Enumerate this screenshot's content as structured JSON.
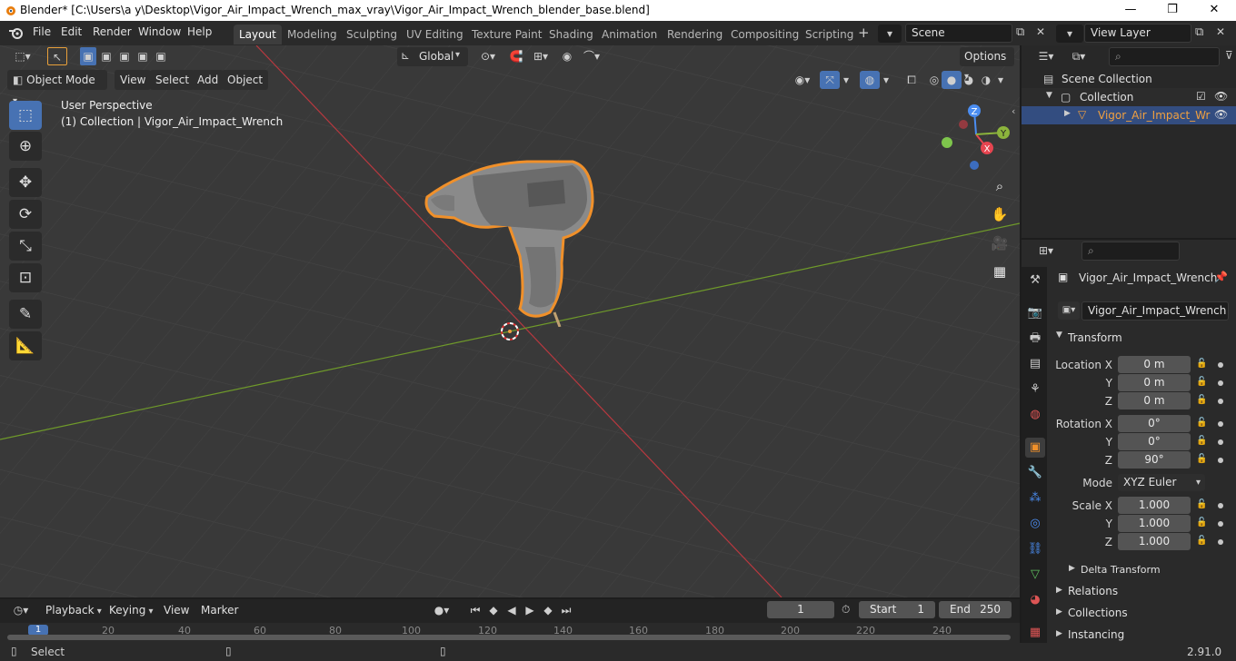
{
  "window": {
    "title": "Blender* [C:\\Users\\a y\\Desktop\\Vigor_Air_Impact_Wrench_max_vray\\Vigor_Air_Impact_Wrench_blender_base.blend]",
    "minimize": "—",
    "maximize": "❐",
    "close": "✕"
  },
  "menubar": {
    "items": [
      "File",
      "Edit",
      "Render",
      "Window",
      "Help"
    ]
  },
  "workspaces": [
    "Layout",
    "Modeling",
    "Sculpting",
    "UV Editing",
    "Texture Paint",
    "Shading",
    "Animation",
    "Rendering",
    "Compositing",
    "Scripting"
  ],
  "scene": {
    "value": "Scene"
  },
  "view_layer": {
    "value": "View Layer"
  },
  "tool_header": {
    "orientation": "Global",
    "options": "Options"
  },
  "viewport_header": {
    "mode": "Object Mode",
    "menus": [
      "View",
      "Select",
      "Add",
      "Object"
    ]
  },
  "viewport": {
    "perspective": "User Perspective",
    "collection_info": "(1) Collection | Vigor_Air_Impact_Wrench",
    "gizmo": {
      "x": "X",
      "y": "Y",
      "z": "Z"
    }
  },
  "outliner": {
    "scene_collection": "Scene Collection",
    "collection": "Collection",
    "object": "Vigor_Air_Impact_Wr"
  },
  "properties": {
    "object_name": "Vigor_Air_Impact_Wrench",
    "object_field": "Vigor_Air_Impact_Wrench",
    "transform_label": "Transform",
    "location_x_label": "Location X",
    "location_y_label": "Y",
    "location_z_label": "Z",
    "location": [
      "0 m",
      "0 m",
      "0 m"
    ],
    "rotation_x_label": "Rotation X",
    "rotation_y_label": "Y",
    "rotation_z_label": "Z",
    "rotation": [
      "0°",
      "0°",
      "90°"
    ],
    "mode_label": "Mode",
    "mode_value": "XYZ Euler",
    "scale_x_label": "Scale X",
    "scale_y_label": "Y",
    "scale_z_label": "Z",
    "scale": [
      "1.000",
      "1.000",
      "1.000"
    ],
    "delta_transform": "Delta Transform",
    "relations": "Relations",
    "collections": "Collections",
    "instancing": "Instancing"
  },
  "timeline": {
    "menus": [
      "Playback",
      "Keying",
      "View",
      "Marker"
    ],
    "current_frame": "1",
    "start_label": "Start",
    "start": "1",
    "end_label": "End",
    "end": "250",
    "ruler": [
      "1",
      "20",
      "40",
      "60",
      "80",
      "100",
      "120",
      "140",
      "160",
      "180",
      "200",
      "220",
      "240"
    ]
  },
  "statusbar": {
    "left": "Select",
    "version": "2.91.0"
  },
  "colors": {
    "accent": "#4772b3",
    "selection_outline": "#f0902a",
    "x_axis": "#b8383f",
    "y_axis": "#6f9a2a"
  }
}
